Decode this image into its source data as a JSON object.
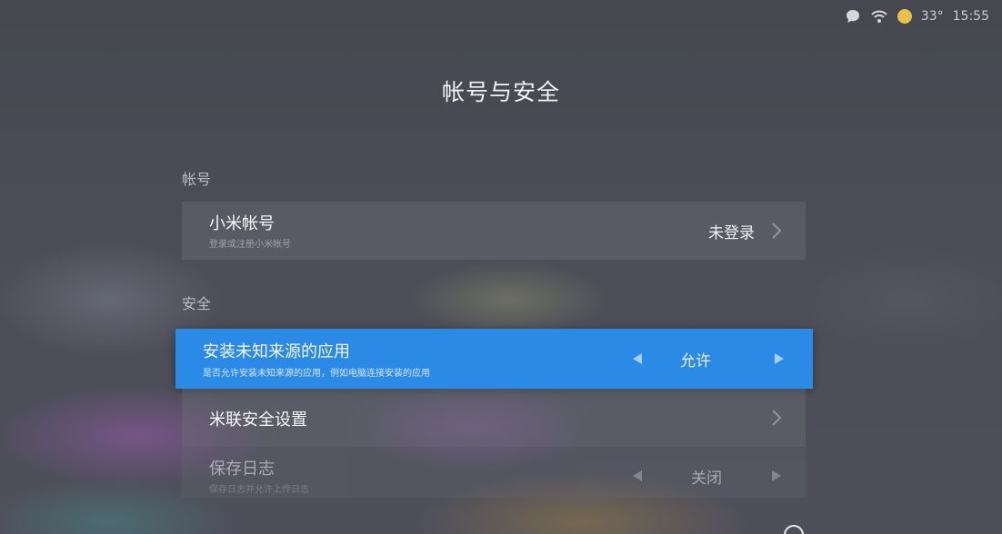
{
  "status": {
    "temperature": "33°",
    "time": "15:55"
  },
  "page": {
    "title": "帐号与安全"
  },
  "sections": {
    "account_label": "帐号",
    "security_label": "安全"
  },
  "account_row": {
    "title": "小米帐号",
    "subtitle": "登录或注册小米帐号",
    "value": "未登录"
  },
  "unknown_sources_row": {
    "title": "安装未知来源的应用",
    "subtitle": "是否允许安装未知来源的应用，例如电脑连接安装的应用",
    "value": "允许"
  },
  "milian_row": {
    "title": "米联安全设置"
  },
  "save_log_row": {
    "title": "保存日志",
    "subtitle": "保存日志并允许上传日志",
    "value": "关闭"
  },
  "colors": {
    "accent": "#2b8ae6",
    "sun": "#e6c24a"
  }
}
